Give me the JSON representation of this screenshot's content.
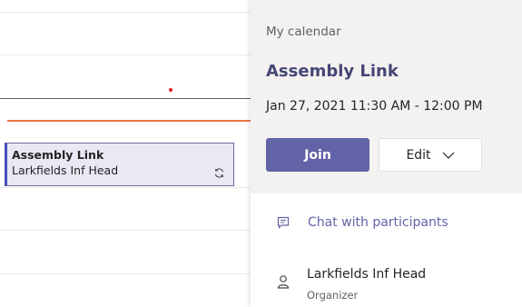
{
  "event_card": {
    "title": "Assembly Link",
    "subtitle": "Larkfields Inf Head",
    "icon": "sync-icon"
  },
  "details": {
    "calendar_name": "My calendar",
    "title": "Assembly Link",
    "time": "Jan 27, 2021 11:30 AM - 12:00 PM",
    "join_label": "Join",
    "edit_label": "Edit",
    "chat_label": "Chat with participants",
    "chat_icon": "chat-icon",
    "organizer_name": "Larkfields Inf Head",
    "organizer_role": "Organizer",
    "organizer_icon": "person-icon"
  },
  "colors": {
    "accent": "#6264a7",
    "title": "#464775",
    "time_indicator": "#e97548",
    "event_bg": "#e8e9f5"
  }
}
